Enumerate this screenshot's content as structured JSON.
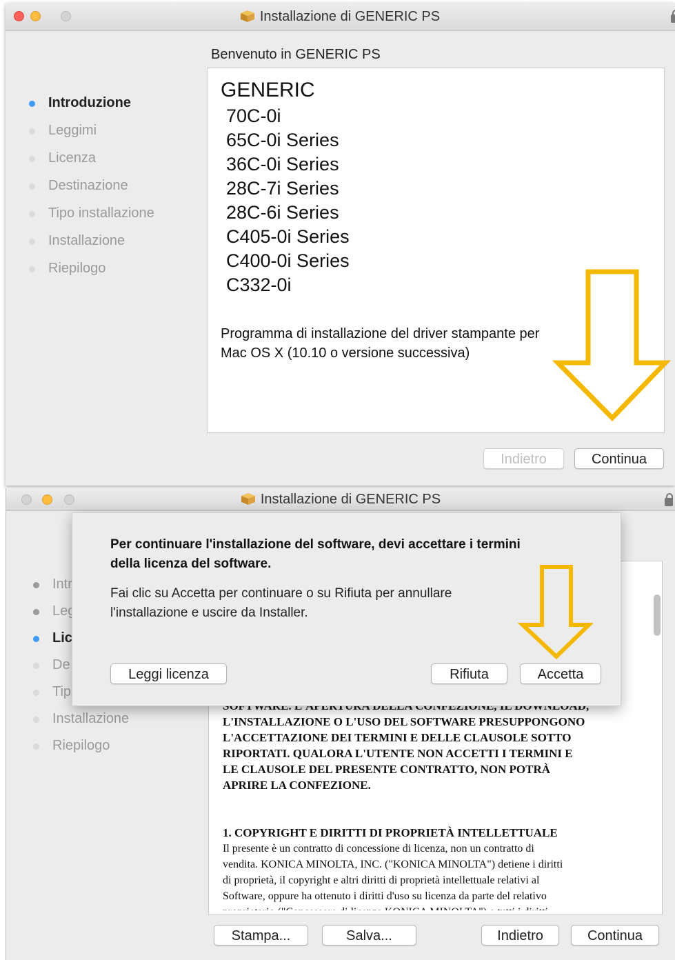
{
  "window1": {
    "title": "Installazione di GENERIC PS",
    "heading": "Benvenuto in GENERIC PS",
    "steps": [
      {
        "label": "Introduzione",
        "state": "active"
      },
      {
        "label": "Leggimi",
        "state": "pending"
      },
      {
        "label": "Licenza",
        "state": "pending"
      },
      {
        "label": "Destinazione",
        "state": "pending"
      },
      {
        "label": "Tipo installazione",
        "state": "pending"
      },
      {
        "label": "Installazione",
        "state": "pending"
      },
      {
        "label": "Riepilogo",
        "state": "pending"
      }
    ],
    "content": {
      "brand": "GENERIC",
      "models": [
        "70C-0i",
        "65C-0i Series",
        "36C-0i Series",
        "28C-7i Series",
        "28C-6i Series",
        "C405-0i Series",
        "C400-0i Series",
        "C332-0i"
      ],
      "description_line1": "Programma di installazione del driver stampante per",
      "description_line2": "Mac OS X (10.10 o versione successiva)"
    },
    "buttons": {
      "back": "Indietro",
      "continue": "Continua"
    }
  },
  "window2": {
    "title": "Installazione di GENERIC PS",
    "steps": [
      {
        "label": "Intr",
        "state": "done"
      },
      {
        "label": "Leg",
        "state": "done"
      },
      {
        "label": "Lic",
        "state": "active"
      },
      {
        "label": "De",
        "state": "pending"
      },
      {
        "label": "Tip",
        "state": "pending"
      },
      {
        "label": "Installazione",
        "state": "pending"
      },
      {
        "label": "Riepilogo",
        "state": "pending"
      }
    ],
    "dialog": {
      "title_line1": "Per continuare l'installazione del software, devi accettare i termini",
      "title_line2": "della licenza del software.",
      "message_line1": "Fai clic su Accetta per continuare o su Rifiuta per annullare",
      "message_line2": "l'installazione e uscire da Installer.",
      "read_license": "Leggi licenza",
      "reject": "Rifiuta",
      "accept": "Accetta"
    },
    "license": {
      "cut_line": "SOFTWARE. L'APERTURA DELLA CONFEZIONE, IL DOWNLOAD,",
      "bold_lines": [
        "L'INSTALLAZIONE O L'USO DEL SOFTWARE PRESUPPONGONO",
        "L'ACCETTAZIONE DEI TERMINI E DELLE CLAUSOLE SOTTO",
        "RIPORTATI. QUALORA L'UTENTE NON ACCETTI I TERMINI E",
        "LE CLAUSOLE DEL PRESENTE CONTRATTO, NON POTRÀ",
        "APRIRE LA CONFEZIONE."
      ],
      "section_title": "1. COPYRIGHT E DIRITTI DI PROPRIETÀ INTELLETTUALE",
      "body_lines": [
        "Il presente è un contratto di concessione di licenza, non un contratto di",
        "vendita. KONICA MINOLTA, INC. (\"KONICA MINOLTA\") detiene i diritti",
        "di proprietà, il copyright e altri diritti di proprietà intellettuale relativi al",
        "Software, oppure ha ottenuto i diritti d'uso su licenza da parte del relativo"
      ],
      "body_cut_line": "proprietario (\"Concessore di licenza KONICA MINOLTA\") e tutti i diritti"
    },
    "buttons": {
      "print": "Stampa...",
      "save": "Salva...",
      "back": "Indietro",
      "continue": "Continua"
    }
  },
  "colors": {
    "accent_arrow": "#f5b800",
    "active_dot": "#3f9bf5"
  }
}
